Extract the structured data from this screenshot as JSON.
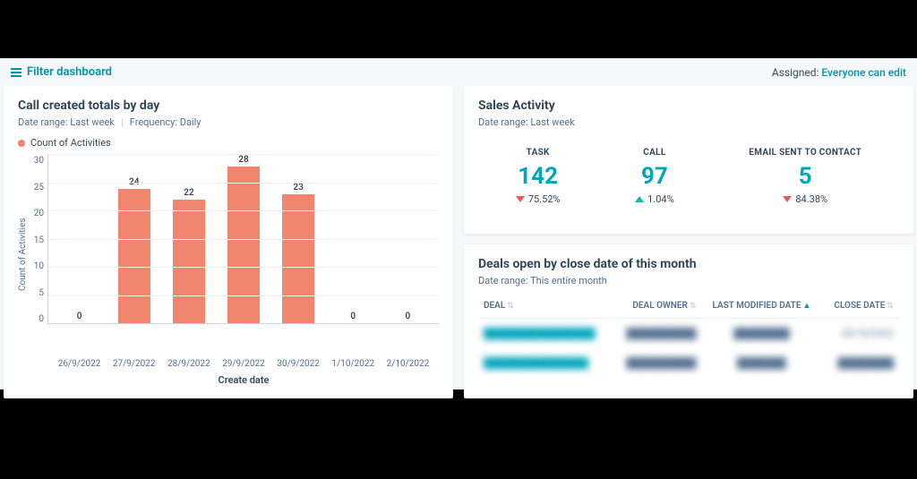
{
  "topbar": {
    "filter_label": "Filter dashboard",
    "assigned_label": "Assigned:",
    "assigned_value": "Everyone can edit"
  },
  "chart_card": {
    "title": "Call created totals by day",
    "date_range": "Date range: Last week",
    "frequency": "Frequency: Daily",
    "legend": "Count of Activities"
  },
  "chart_data": {
    "type": "bar",
    "title": "Call created totals by day",
    "xlabel": "Create date",
    "ylabel": "Count of Activities",
    "ylim": [
      0,
      30
    ],
    "y_ticks": [
      0,
      5,
      10,
      15,
      20,
      25,
      30
    ],
    "categories": [
      "26/9/2022",
      "27/9/2022",
      "28/9/2022",
      "29/9/2022",
      "30/9/2022",
      "1/10/2022",
      "2/10/2022"
    ],
    "values": [
      0,
      24,
      22,
      28,
      23,
      0,
      0
    ],
    "series_name": "Count of Activities",
    "series_color": "#f2856d"
  },
  "sales_activity": {
    "title": "Sales Activity",
    "date_range": "Date range: Last week",
    "stats": [
      {
        "label": "TASK",
        "value": "142",
        "direction": "down",
        "delta": "75.52%"
      },
      {
        "label": "CALL",
        "value": "97",
        "direction": "up",
        "delta": "1.04%"
      },
      {
        "label": "EMAIL SENT TO CONTACT",
        "value": "5",
        "direction": "down",
        "delta": "84.38%"
      }
    ]
  },
  "deals": {
    "title": "Deals open by close date of this month",
    "date_range": "Date range: This entire month",
    "columns": {
      "deal": "DEAL",
      "owner": "DEAL OWNER",
      "modified": "LAST MODIFIED DATE",
      "close": "CLOSE DATE"
    },
    "rows": [
      {
        "deal": "████████████████",
        "owner": "██████████",
        "modified": "████████",
        "close": "28/10/2022"
      },
      {
        "deal": "███████████████",
        "owner": "██████████",
        "modified": "███████",
        "close": "████████"
      }
    ]
  }
}
